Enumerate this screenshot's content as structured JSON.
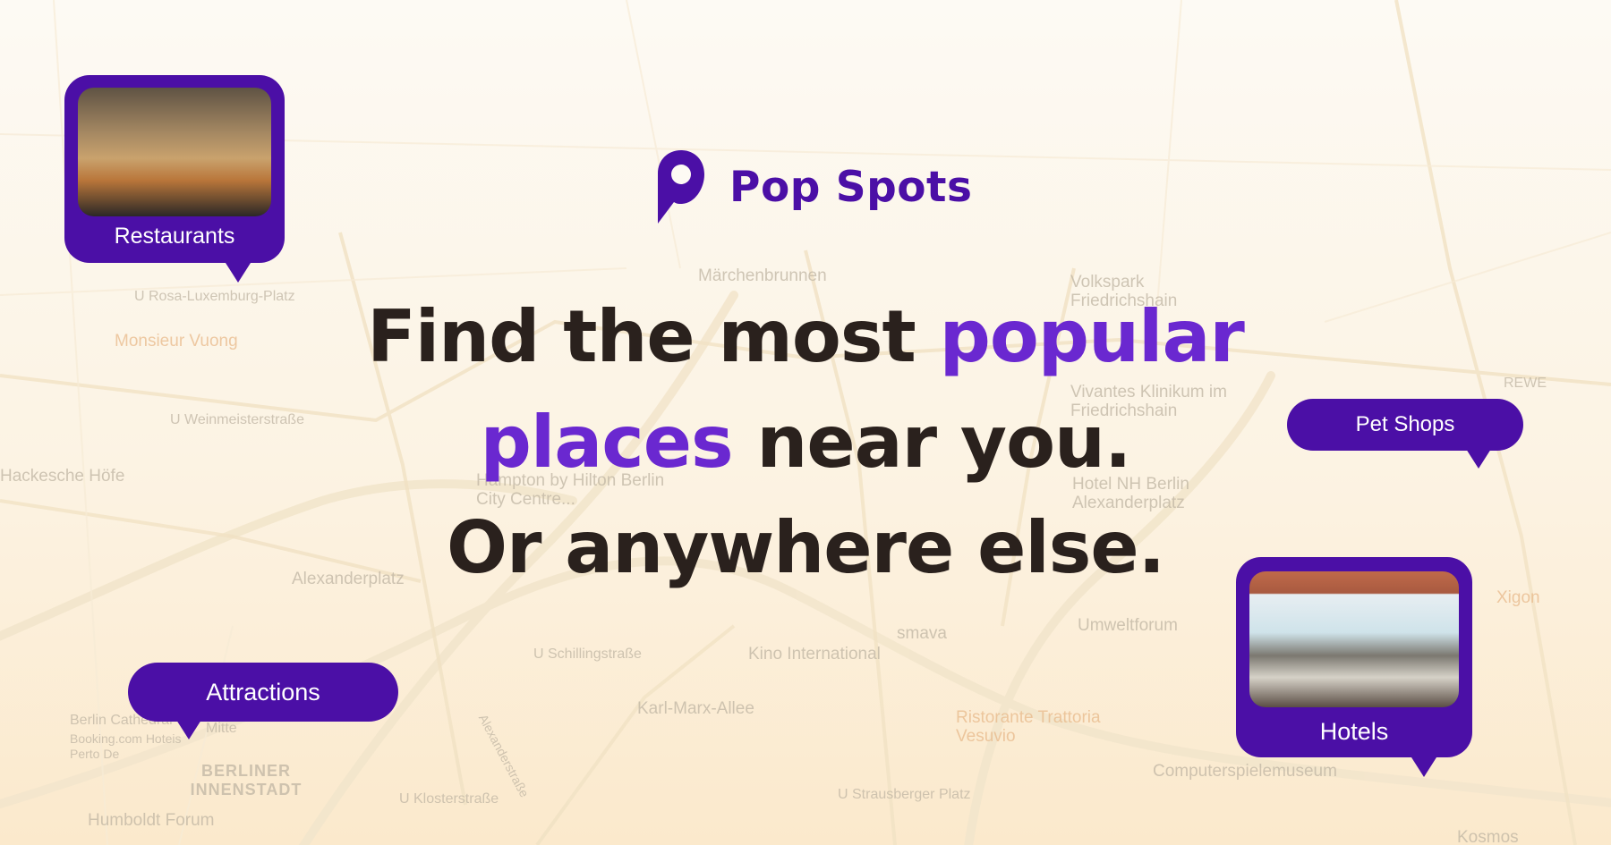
{
  "brand": {
    "name": "Pop Spots",
    "color": "#4b0fa6"
  },
  "headline": {
    "part1": "Find the most ",
    "accent1": "popular",
    "accent2": "places",
    "part2": " near you.",
    "line3": "Or anywhere else.",
    "text_color": "#2a211d",
    "accent_color": "#6a28d0"
  },
  "bubbles": {
    "restaurants": "Restaurants",
    "pet_shops": "Pet Shops",
    "attractions": "Attractions",
    "hotels": "Hotels"
  },
  "map_labels": [
    {
      "text": "U Rosa-Luxemburg-Platz",
      "icon": "metro-icon"
    },
    {
      "text": "Monsieur Vuong",
      "icon": "food-icon"
    },
    {
      "text": "U Weinmeisterstraße",
      "icon": "metro-icon"
    },
    {
      "text": "Märchenbrunnen",
      "icon": "pin-icon"
    },
    {
      "text": "Volkspark Friedrichshain",
      "icon": "pin-icon"
    },
    {
      "text": "Vivantes Klinikum im Friedrichshain",
      "icon": "hospital-icon"
    },
    {
      "text": "REWE",
      "icon": "shop-icon"
    },
    {
      "text": "Hackesche Höfe",
      "icon": "pin-icon"
    },
    {
      "text": "Hampton by Hilton Berlin City Centre...",
      "icon": "hotel-icon"
    },
    {
      "text": "Hotel NH Berlin Alexanderplatz",
      "icon": "hotel-icon"
    },
    {
      "text": "Alexanderplatz",
      "icon": "pin-icon"
    },
    {
      "text": "Umweltforum",
      "icon": "pin-icon"
    },
    {
      "text": "Xigon",
      "icon": "food-icon"
    },
    {
      "text": "smava",
      "icon": "pin-icon"
    },
    {
      "text": "U Schillingstraße",
      "icon": "metro-icon"
    },
    {
      "text": "Kino International",
      "icon": "cinema-icon"
    },
    {
      "text": "Karl-Marx-Allee",
      "icon": "pin-icon"
    },
    {
      "text": "Ristorante Trattoria Vesuvio",
      "icon": "food-icon"
    },
    {
      "text": "Berlin Cathedral",
      "icon": "church-icon"
    },
    {
      "text": "Booking.com Hoteis Perto De",
      "icon": "hotel-icon"
    },
    {
      "text": "BERLINER INNENSTADT",
      "icon": ""
    },
    {
      "text": "Humboldt Forum",
      "icon": "pin-icon"
    },
    {
      "text": "U Klosterstraße",
      "icon": "metro-icon"
    },
    {
      "text": "U Strausberger Platz",
      "icon": "metro-icon"
    },
    {
      "text": "Computerspielemuseum",
      "icon": "pin-icon"
    },
    {
      "text": "Kosmos",
      "icon": "pin-icon"
    },
    {
      "text": "Alexanderstraße",
      "icon": ""
    },
    {
      "text": "Mitte",
      "icon": ""
    }
  ]
}
